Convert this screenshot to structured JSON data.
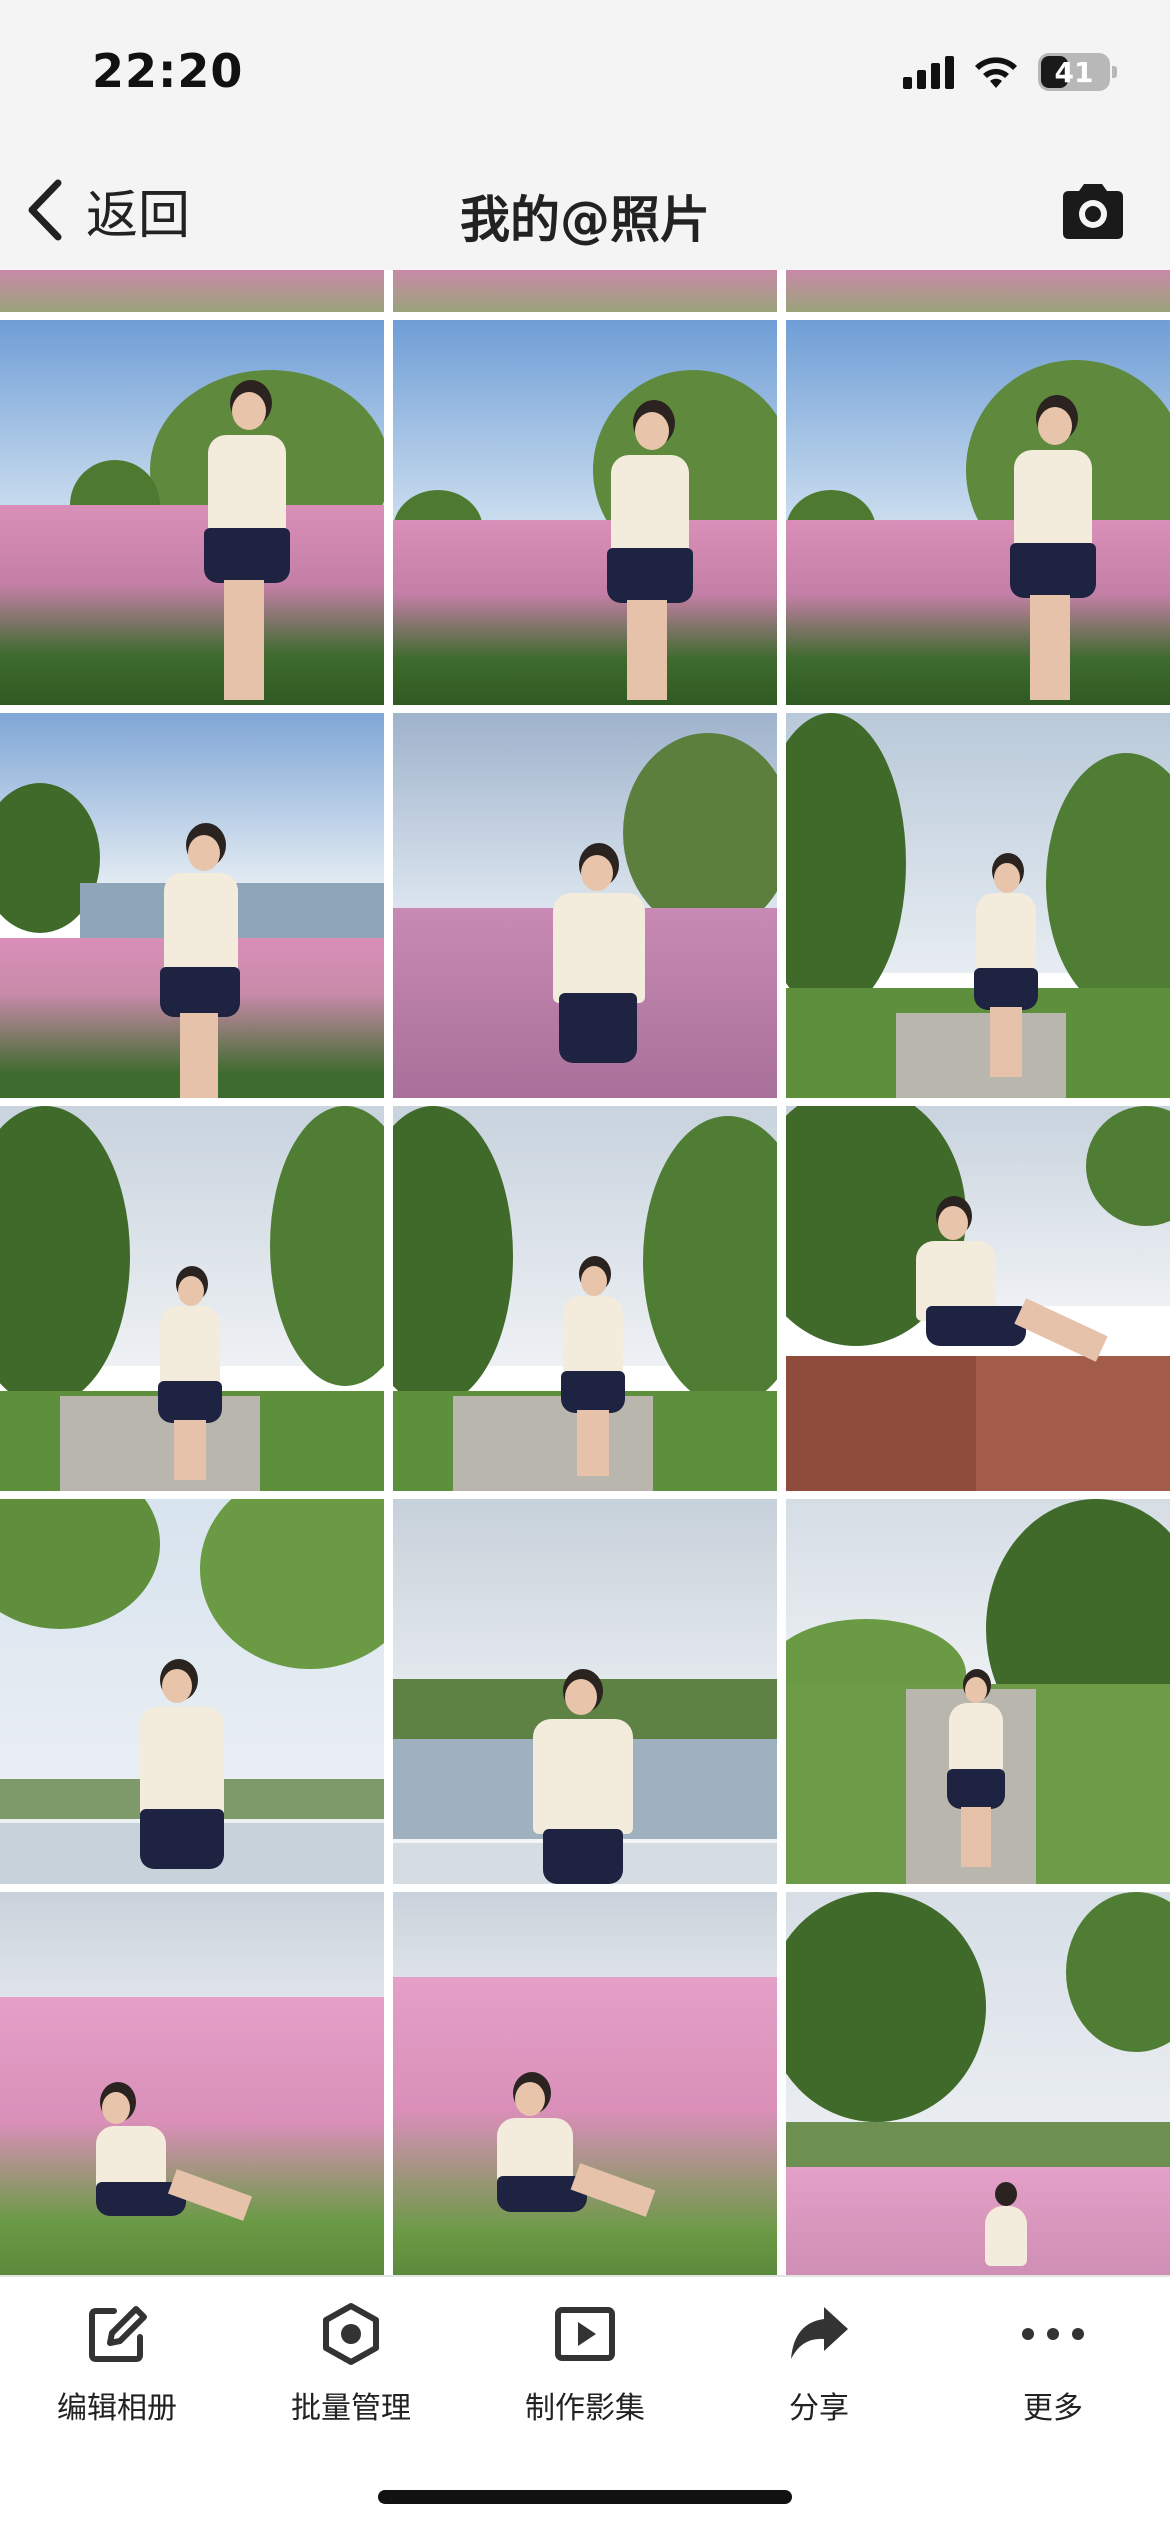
{
  "status_bar": {
    "time": "22:20",
    "battery_level": "41",
    "battery_fraction": 0.41
  },
  "nav": {
    "back_label": "返回",
    "title": "我的@照片"
  },
  "photo_grid": {
    "columns": 3,
    "visible_rows": 5,
    "photo_count": 15
  },
  "toolbar": {
    "items": [
      {
        "label": "编辑相册",
        "icon": "edit-icon"
      },
      {
        "label": "批量管理",
        "icon": "manage-icon"
      },
      {
        "label": "制作影集",
        "icon": "video-icon"
      },
      {
        "label": "分享",
        "icon": "share-icon"
      },
      {
        "label": "更多",
        "icon": "more-icon"
      }
    ]
  },
  "colors": {
    "bar_bg": "#f4f4f4",
    "text": "#222222",
    "grass_pink": "#d98fb8"
  }
}
